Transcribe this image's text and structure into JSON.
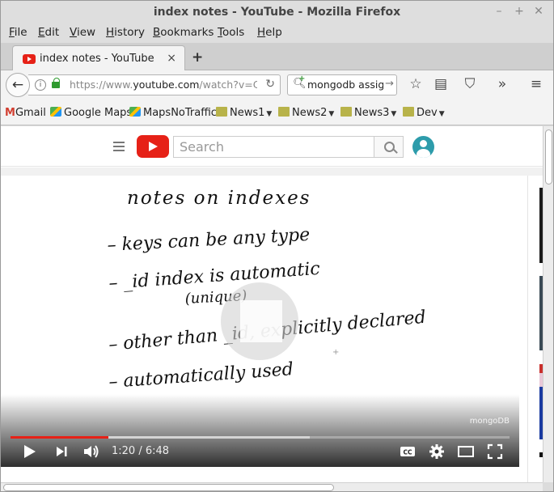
{
  "window": {
    "title": "index notes - YouTube - Mozilla Firefox"
  },
  "menubar": {
    "items": [
      {
        "label": "File",
        "key": "F",
        "rest": "ile"
      },
      {
        "label": "Edit",
        "key": "E",
        "rest": "dit"
      },
      {
        "label": "View",
        "key": "V",
        "rest": "iew"
      },
      {
        "label": "History",
        "key": "H",
        "rest": "istory"
      },
      {
        "label": "Bookmarks",
        "key": "B",
        "rest": "ookmarks"
      },
      {
        "label": "Tools",
        "key": "T",
        "rest": "ools"
      },
      {
        "label": "Help",
        "key": "H",
        "rest": "elp"
      }
    ]
  },
  "tab": {
    "label": "index notes - YouTube",
    "close": "×",
    "new_tab": "+"
  },
  "navbar": {
    "back": "←",
    "info": "i",
    "url_prefix": "https://www.",
    "url_domain": "youtube.com",
    "url_rest": "/watch?v=C",
    "reload": "↻",
    "search_value": "mongodb assign",
    "search_go": "→",
    "icons": [
      "star-icon",
      "reader-list-icon",
      "pocket-icon",
      "overflow-icon",
      "menu-icon"
    ]
  },
  "bookmarks": [
    {
      "label": "Gmail",
      "icon": "gmail-icon",
      "dropdown": false
    },
    {
      "label": "Google Maps",
      "icon": "maps-icon",
      "dropdown": false
    },
    {
      "label": "MapsNoTraffic",
      "icon": "maps-icon",
      "dropdown": false
    },
    {
      "label": "News1",
      "icon": "folder-icon",
      "dropdown": true
    },
    {
      "label": "News2",
      "icon": "folder-icon",
      "dropdown": true
    },
    {
      "label": "News3",
      "icon": "folder-icon",
      "dropdown": true
    },
    {
      "label": "Dev",
      "icon": "folder-icon",
      "dropdown": true
    }
  ],
  "youtube": {
    "search_placeholder": "Search",
    "accent": "#e62117"
  },
  "video": {
    "notes": {
      "title": "notes on indexes",
      "line1": "– keys can be any type",
      "line2": "– _id index is automatic",
      "line2b": "(unique)",
      "line3": "– other than _id, explicitly declared",
      "line4": "– automatically used"
    },
    "watermark": "mongoDB",
    "current_time": "1:20",
    "duration": "6:48",
    "time_display": "1:20 / 6:48",
    "played_fraction": 0.196,
    "buffered_fraction": 0.6,
    "cc_label": "CC"
  }
}
